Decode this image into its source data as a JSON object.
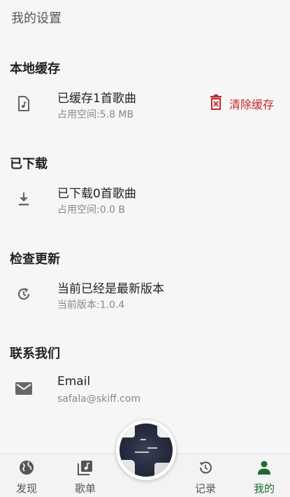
{
  "header": {
    "title": "我的设置"
  },
  "cache": {
    "section_title": "本地缓存",
    "title": "已缓存1首歌曲",
    "subtitle": "占用空间:5.8 MB",
    "clear_label": "清除缓存"
  },
  "downloads": {
    "section_title": "已下载",
    "title": "已下载0首歌曲",
    "subtitle": "占用空间:0.0 B"
  },
  "update": {
    "section_title": "检查更新",
    "title": "当前已经是最新版本",
    "subtitle": "当前版本:1.0.4"
  },
  "contact": {
    "section_title": "联系我们",
    "title": "Email",
    "subtitle": "safala@skiff.com"
  },
  "nav": {
    "items": [
      {
        "label": "发现",
        "icon": "globe-icon"
      },
      {
        "label": "歌单",
        "icon": "playlist-icon"
      },
      {
        "label": "记录",
        "icon": "history-icon"
      },
      {
        "label": "我的",
        "icon": "person-icon",
        "active": true
      }
    ]
  },
  "colors": {
    "accent": "#1b6b2f",
    "danger": "#c62828",
    "background": "#f6f6f6"
  }
}
